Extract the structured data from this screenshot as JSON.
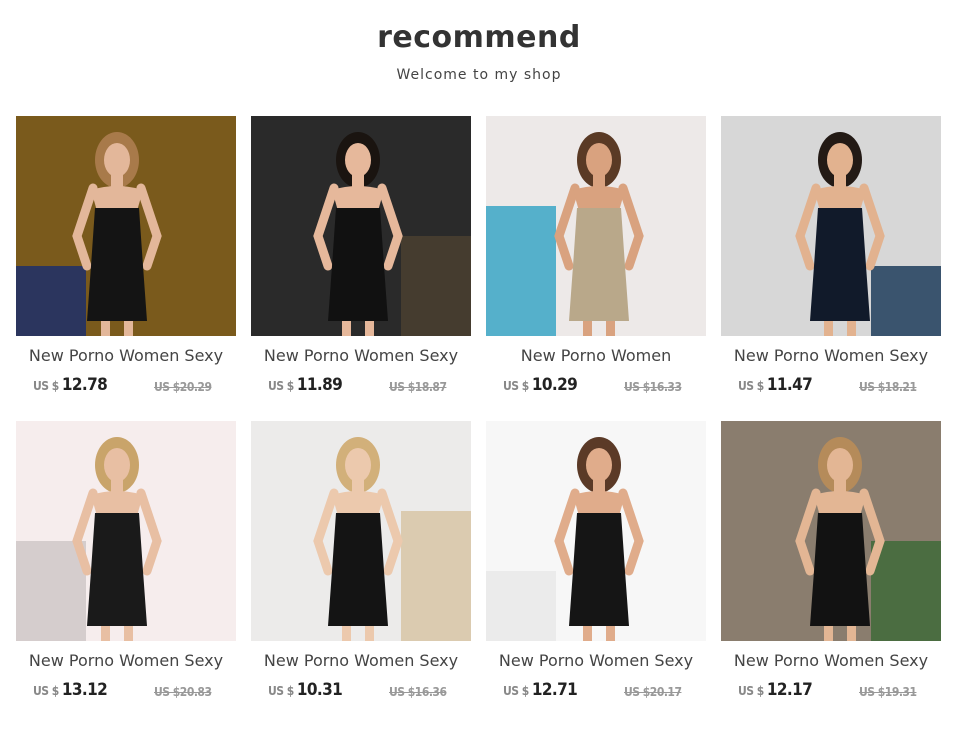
{
  "header": {
    "title": "recommend",
    "subtitle": "Welcome to my shop"
  },
  "products": [
    {
      "name": "New Porno Women Sexy",
      "currency": "US $",
      "price": "12.78",
      "old_price": "US $20.29",
      "bg": "#7a5a1c",
      "accent": "#1d2f6a",
      "dress": "#141414",
      "skin": "#e3b79a",
      "hair": "#a87a4a"
    },
    {
      "name": "New Porno Women Sexy",
      "currency": "US $",
      "price": "11.89",
      "old_price": "US $18.87",
      "bg": "#2a2a2a",
      "accent": "#4a4030",
      "dress": "#111111",
      "skin": "#e6b89b",
      "hair": "#1a1410"
    },
    {
      "name": "New Porno Women",
      "currency": "US $",
      "price": "10.29",
      "old_price": "US $16.33",
      "bg": "#ede9e8",
      "accent": "#3aa6c6",
      "dress": "#b9a88a",
      "skin": "#d9a27f",
      "hair": "#5a3a25"
    },
    {
      "name": "New Porno Women Sexy",
      "currency": "US $",
      "price": "11.47",
      "old_price": "US $18.21",
      "bg": "#d7d7d7",
      "accent": "#1f3d5c",
      "dress": "#111a2a",
      "skin": "#e2b28f",
      "hair": "#231a15"
    },
    {
      "name": "New Porno Women Sexy",
      "currency": "US $",
      "price": "13.12",
      "old_price": "US $20.83",
      "bg": "#f6eded",
      "accent": "#cfc7c7",
      "dress": "#1a1a1a",
      "skin": "#e8bfa3",
      "hair": "#c9a46a"
    },
    {
      "name": "New Porno Women Sexy",
      "currency": "US $",
      "price": "10.31",
      "old_price": "US $16.36",
      "bg": "#ecebea",
      "accent": "#d8c6a6",
      "dress": "#141414",
      "skin": "#ecc9ad",
      "hair": "#d2b07a"
    },
    {
      "name": "New Porno Women Sexy",
      "currency": "US $",
      "price": "12.71",
      "old_price": "US $20.17",
      "bg": "#f7f7f7",
      "accent": "#e9e9e9",
      "dress": "#151515",
      "skin": "#e0ac8b",
      "hair": "#5b3a27"
    },
    {
      "name": "New Porno Women Sexy",
      "currency": "US $",
      "price": "12.17",
      "old_price": "US $19.31",
      "bg": "#8a7d6e",
      "accent": "#3f6a3a",
      "dress": "#121212",
      "skin": "#e3b694",
      "hair": "#b58b5a"
    }
  ]
}
